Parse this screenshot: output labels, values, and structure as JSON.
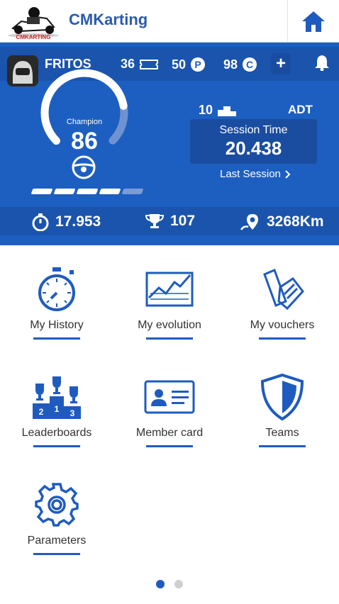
{
  "header": {
    "title": "CMKarting",
    "logo_text": "CMKARTING",
    "home_icon": "home-icon"
  },
  "user": {
    "name": "FRITOS",
    "tickets": "36",
    "points": "50",
    "credits": "98",
    "add_label": "+"
  },
  "gauge": {
    "label": "Champion",
    "value": "86",
    "level_filled": 4,
    "level_total": 5
  },
  "ranking": {
    "position": "10",
    "code": "ADT"
  },
  "session": {
    "label": "Session Time",
    "value": "20.438",
    "last_label": "Last Session"
  },
  "stats": {
    "best_lap": "17.953",
    "trophies": "107",
    "distance": "3268Km"
  },
  "menu": {
    "items": [
      {
        "label": "My History",
        "icon": "stopwatch-icon"
      },
      {
        "label": "My evolution",
        "icon": "chart-icon"
      },
      {
        "label": "My vouchers",
        "icon": "vouchers-icon"
      },
      {
        "label": "Leaderboards",
        "icon": "podium-icon"
      },
      {
        "label": "Member card",
        "icon": "member-card-icon"
      },
      {
        "label": "Teams",
        "icon": "shield-icon"
      },
      {
        "label": "Parameters",
        "icon": "gear-icon"
      }
    ]
  },
  "pagination": {
    "current": 1,
    "total": 2
  },
  "colors": {
    "primary": "#1d5fc0",
    "dark": "#1a54ad",
    "accent_line": "#1f5bbf"
  }
}
